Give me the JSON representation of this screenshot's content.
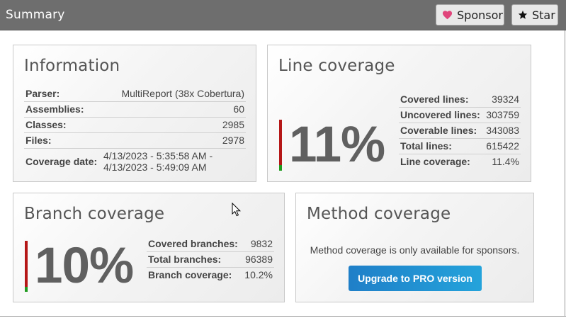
{
  "header": {
    "title": "Summary",
    "sponsor_label": "Sponsor",
    "star_label": "Star"
  },
  "information": {
    "title": "Information",
    "rows": [
      {
        "key": "Parser:",
        "value": "MultiReport (38x Cobertura)"
      },
      {
        "key": "Assemblies:",
        "value": "60"
      },
      {
        "key": "Classes:",
        "value": "2985"
      },
      {
        "key": "Files:",
        "value": "2978"
      },
      {
        "key": "Coverage date:",
        "value_line1": "4/13/2023 - 5:35:58 AM -",
        "value_line2": "4/13/2023 - 5:49:09 AM"
      }
    ]
  },
  "line_coverage": {
    "title": "Line coverage",
    "percent_label": "11%",
    "percent": 11.4,
    "rows": [
      {
        "key": "Covered lines:",
        "value": "39324"
      },
      {
        "key": "Uncovered lines:",
        "value": "303759"
      },
      {
        "key": "Coverable lines:",
        "value": "343083"
      },
      {
        "key": "Total lines:",
        "value": "615422"
      },
      {
        "key": "Line coverage:",
        "value": "11.4%"
      }
    ]
  },
  "branch_coverage": {
    "title": "Branch coverage",
    "percent_label": "10%",
    "percent": 10.2,
    "rows": [
      {
        "key": "Covered branches:",
        "value": "9832"
      },
      {
        "key": "Total branches:",
        "value": "96389"
      },
      {
        "key": "Branch coverage:",
        "value": "10.2%"
      }
    ]
  },
  "method_coverage": {
    "title": "Method coverage",
    "message": "Method coverage is only available for sponsors.",
    "upgrade_label": "Upgrade to PRO version"
  },
  "icons": {
    "sponsor": "heart-icon",
    "star": "star-icon",
    "cursor": "mouse-pointer-icon"
  },
  "colors": {
    "header_bg": "#6e6e6e",
    "heart": "#e0457b",
    "coverage_uncovered": "#b51717",
    "coverage_covered": "#1f9b1f",
    "upgrade_button": "#1f7fc8"
  }
}
